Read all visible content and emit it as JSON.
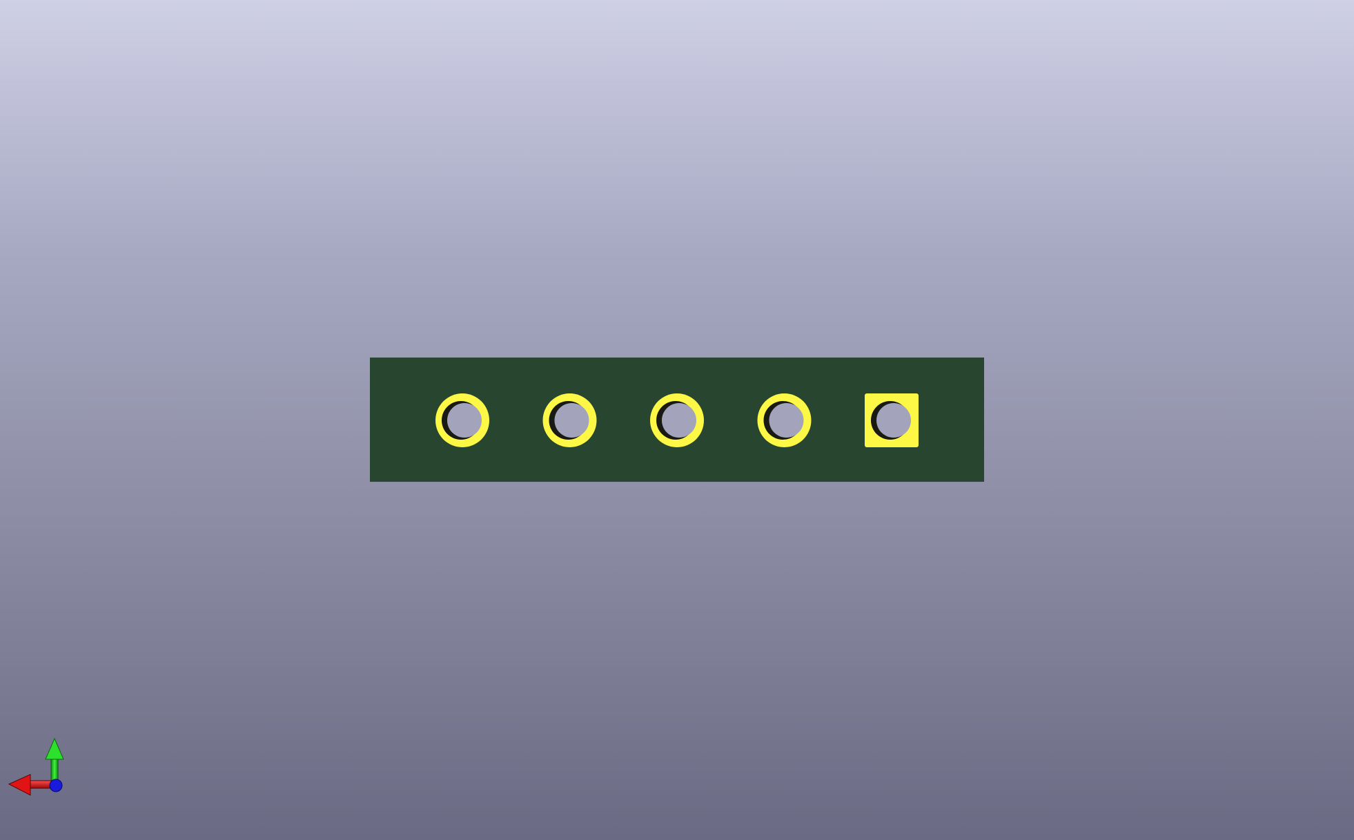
{
  "viewer": {
    "background_top_color": "#cfd0e6",
    "background_bottom_color": "#6a6a84"
  },
  "board": {
    "substrate_color": "#284530",
    "copper_color": "#fdf845",
    "hole_color": "#a3a4bc",
    "pin_count": 5,
    "pads": [
      {
        "pin": 1,
        "shape": "round"
      },
      {
        "pin": 2,
        "shape": "round"
      },
      {
        "pin": 3,
        "shape": "round"
      },
      {
        "pin": 4,
        "shape": "round"
      },
      {
        "pin": 5,
        "shape": "square"
      }
    ]
  },
  "axis_gizmo": {
    "x_axis_color": "#e01414",
    "y_axis_color": "#1fd61f",
    "z_axis_color": "#1a1adc",
    "icon": "axes-orientation-icon"
  }
}
